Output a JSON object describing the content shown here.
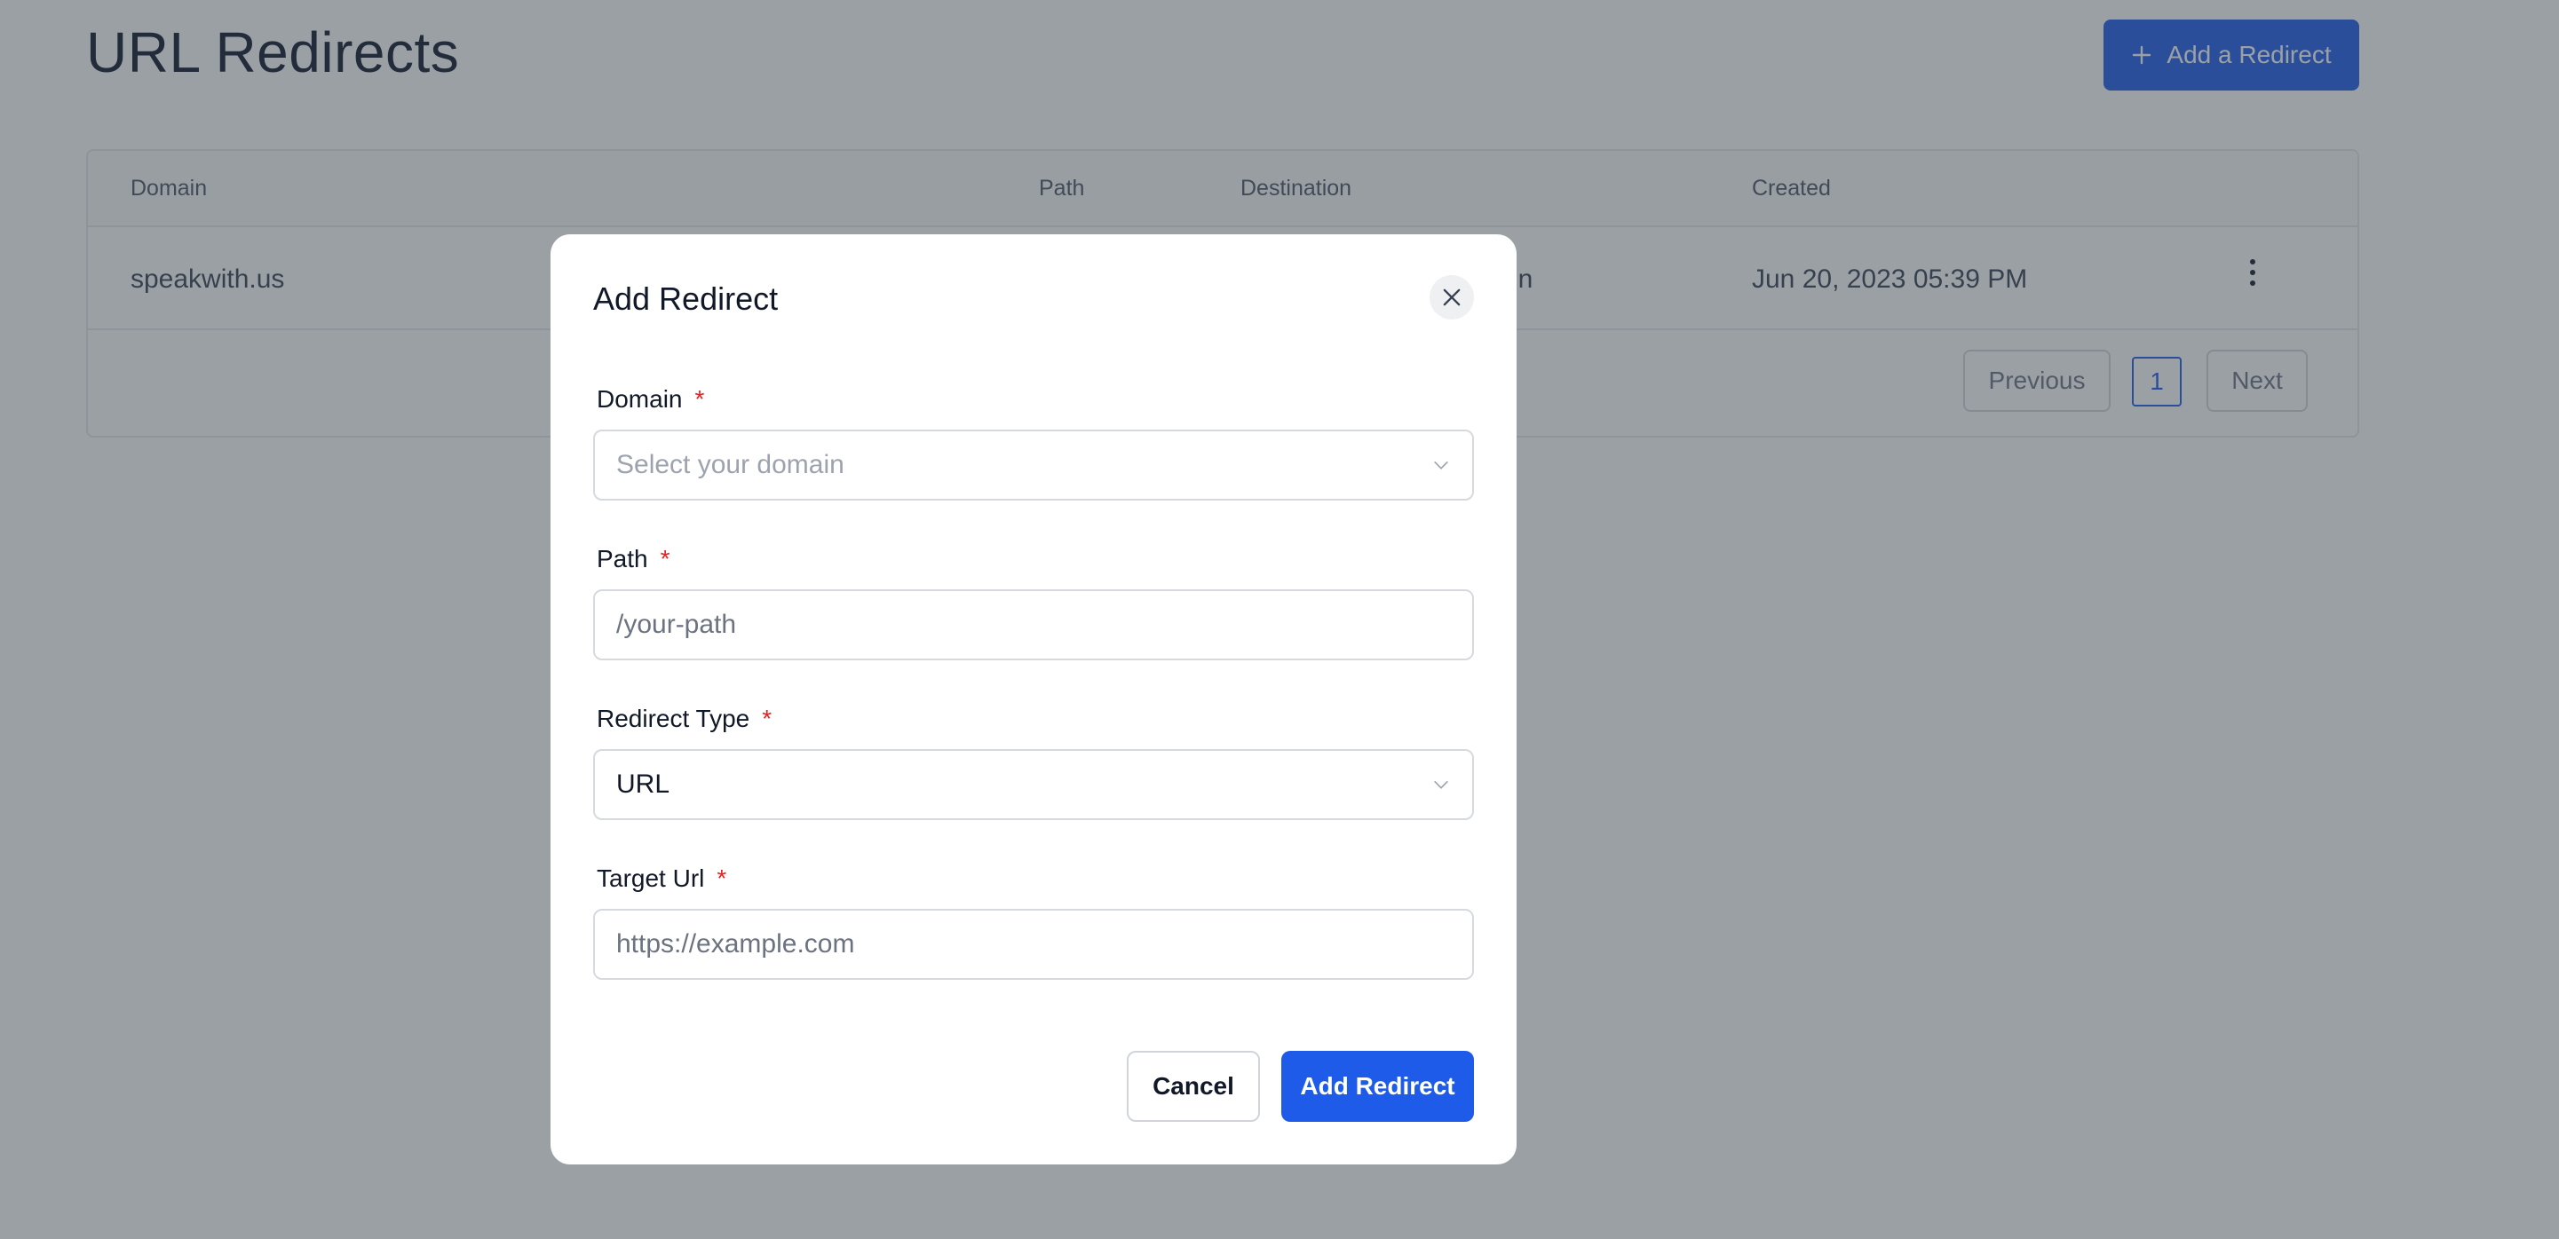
{
  "page": {
    "title": "URL Redirects",
    "add_button_label": "Add a Redirect"
  },
  "table": {
    "columns": [
      "Domain",
      "Path",
      "Destination",
      "Created"
    ],
    "rows": [
      {
        "domain": "speakwith.us",
        "destination_visible_fragment": "in",
        "created": "Jun 20, 2023 05:39 PM"
      }
    ],
    "pagination": {
      "previous_label": "Previous",
      "current_page": "1",
      "next_label": "Next"
    }
  },
  "modal": {
    "title": "Add Redirect",
    "required_marker": "*",
    "fields": {
      "domain": {
        "label": "Domain",
        "placeholder": "Select your domain"
      },
      "path": {
        "label": "Path",
        "placeholder": "/your-path"
      },
      "redirect_type": {
        "label": "Redirect Type",
        "value": "URL"
      },
      "target_url": {
        "label": "Target Url",
        "placeholder": "https://example.com"
      }
    },
    "buttons": {
      "cancel": "Cancel",
      "submit": "Add Redirect"
    }
  },
  "colors": {
    "primary": "#1d5be8",
    "required": "#dc2626",
    "overlay": "rgba(55,65,75,0.5)"
  },
  "icons": {
    "add": "plus-icon",
    "close": "close-icon",
    "dropdown": "chevron-down-icon",
    "row_menu": "kebab-menu-icon"
  }
}
